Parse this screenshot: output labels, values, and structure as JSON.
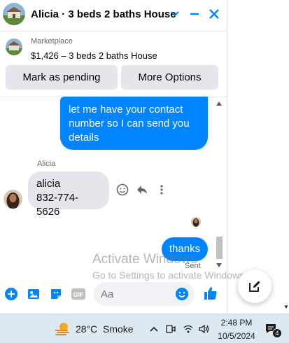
{
  "header": {
    "title": "Alicia · 3 beds 2 baths House",
    "icons": [
      "chevron-down-icon",
      "minimize-icon",
      "close-icon"
    ]
  },
  "marketplace": {
    "label": "Marketplace",
    "listing": "$1,426 – 3 beds 2 baths House"
  },
  "actions": {
    "mark_pending": "Mark as pending",
    "more_options": "More Options"
  },
  "messages": {
    "outgoing_1": [
      "let me have your contact",
      "number so I can send you",
      "details"
    ],
    "sender_name": "Alicia",
    "incoming_1": [
      "alicia",
      "832-774-5626"
    ],
    "outgoing_2": "thanks",
    "status": "Sent"
  },
  "watermark": {
    "line1": "Activate Windows",
    "line2": "Go to Settings to activate Windows."
  },
  "composer": {
    "placeholder": "Aa",
    "icons": [
      "plus-icon",
      "photo-icon",
      "sticker-icon",
      "gif-icon",
      "emoji-icon",
      "thumbs-up-icon"
    ]
  },
  "taskbar": {
    "temperature": "28°C",
    "condition": "Smoke",
    "time": "2:48 PM",
    "date": "10/5/2024",
    "notification_count": "4"
  },
  "colors": {
    "accent": "#0084ff",
    "bubble_in": "#e4e6eb",
    "taskbar": "#dce8f2"
  }
}
